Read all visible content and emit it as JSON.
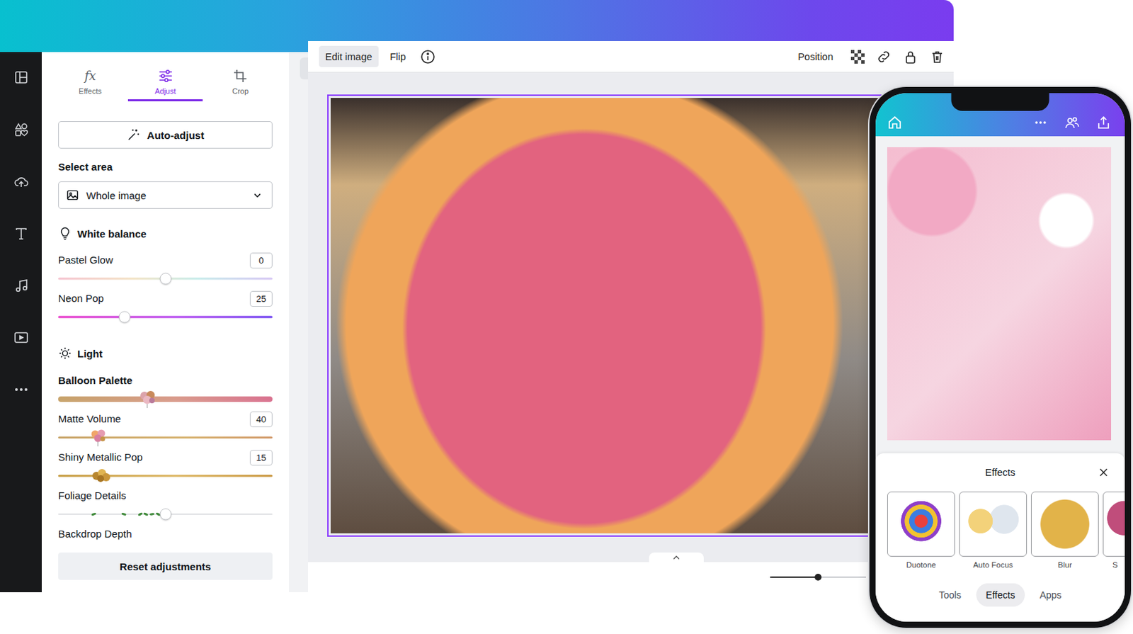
{
  "editor": {
    "panel": {
      "tabs": [
        {
          "label": "Effects",
          "glyph": "fx",
          "selected": false
        },
        {
          "label": "Adjust",
          "selected": true
        },
        {
          "label": "Crop",
          "selected": false
        }
      ],
      "auto_adjust": "Auto-adjust",
      "select_area": {
        "label": "Select area",
        "value": "Whole image"
      },
      "sections": [
        {
          "title": "White balance",
          "controls": [
            {
              "label": "Pastel Glow",
              "value": "0",
              "level": 0.5,
              "kind": "pastel"
            },
            {
              "label": "Neon Pop",
              "value": "25",
              "level": 0.31,
              "kind": "neon"
            }
          ]
        },
        {
          "title": "Light",
          "controls": [
            {
              "label": "Balloon Palette",
              "level": 0.42,
              "kind": "palette"
            },
            {
              "label": "Matte Volume",
              "value": "40",
              "level": 0.19,
              "kind": "balloon"
            },
            {
              "label": "Shiny Metallic Pop",
              "value": "15",
              "level": 0.2,
              "kind": "metallic"
            },
            {
              "label": "Foliage Details",
              "level": 0.5,
              "kind": "foliage"
            },
            {
              "label": "Backdrop Depth",
              "kind": "label"
            }
          ]
        }
      ],
      "reset": "Reset adjustments"
    },
    "toolbar": {
      "left": [
        {
          "label": "Edit image",
          "selected": true
        },
        {
          "label": "Flip",
          "selected": false
        }
      ],
      "position": "Position"
    },
    "zoom": {
      "level": 0.5
    }
  },
  "phone": {
    "effects": {
      "title": "Effects",
      "items": [
        {
          "label": "Duotone",
          "selected": false
        },
        {
          "label": "Auto Focus",
          "selected": false
        },
        {
          "label": "Blur",
          "selected": false
        },
        {
          "label": "S",
          "selected": false
        }
      ]
    },
    "tabs": [
      {
        "label": "Tools",
        "selected": false
      },
      {
        "label": "Effects",
        "selected": true
      },
      {
        "label": "Apps",
        "selected": false
      }
    ]
  }
}
